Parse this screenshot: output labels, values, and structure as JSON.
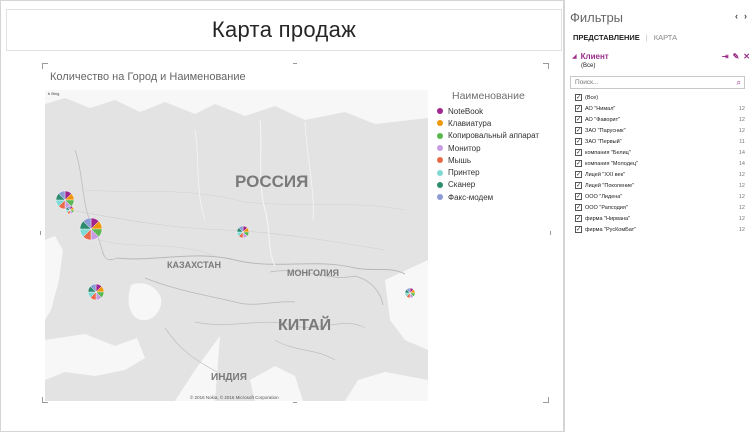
{
  "canvas": {
    "title": "Карта продаж"
  },
  "visual": {
    "title": "Количество на Город и Наименование",
    "map_labels": [
      "РОССИЯ",
      "КАЗАХСТАН",
      "МОНГОЛИЯ",
      "КИТАЙ",
      "ИНДИЯ"
    ],
    "copyright": "© 2016 Nokia, © 2016 Microsoft Corporation",
    "bing_label": "b Bing"
  },
  "legend": {
    "title": "Наименование",
    "items": [
      {
        "label": "NoteBook",
        "color": "#a0258c"
      },
      {
        "label": "Клавиатура",
        "color": "#f0960a"
      },
      {
        "label": "Копировальный аппарат",
        "color": "#59b84f"
      },
      {
        "label": "Монитор",
        "color": "#c79be0"
      },
      {
        "label": "Мышь",
        "color": "#e96a4a"
      },
      {
        "label": "Принтер",
        "color": "#7fd9d4"
      },
      {
        "label": "Сканер",
        "color": "#2e8b6e"
      },
      {
        "label": "Факс-модем",
        "color": "#8a9bd6"
      }
    ]
  },
  "filters": {
    "header": "Фильтры",
    "header_icons": [
      "chevron-left",
      "chevron-right"
    ],
    "tabs": [
      "ПРЕДСТАВЛЕНИЕ",
      "КАРТА"
    ],
    "active_tab": "ПРЕДСТАВЛЕНИЕ",
    "field": {
      "name": "Клиент",
      "state": "(Все)"
    },
    "search_placeholder": "Поиск...",
    "items": [
      {
        "label": "(Все)",
        "count": ""
      },
      {
        "label": "АО \"Нимал\"",
        "count": "12"
      },
      {
        "label": "АО \"Фаворит\"",
        "count": "12"
      },
      {
        "label": "ЗАО \"Парусник\"",
        "count": "12"
      },
      {
        "label": "ЗАО \"Первый\"",
        "count": "11"
      },
      {
        "label": "компания \"Белиц\"",
        "count": "14"
      },
      {
        "label": "компания \"Молодец\"",
        "count": "14"
      },
      {
        "label": "Лицей \"XXI век\"",
        "count": "12"
      },
      {
        "label": "Лицей \"Поколение\"",
        "count": "12"
      },
      {
        "label": "ООО \"Лидена\"",
        "count": "12"
      },
      {
        "label": "ООО \"Рапсодия\"",
        "count": "12"
      },
      {
        "label": "фирма \"Нирвана\"",
        "count": "12"
      },
      {
        "label": "фирма \"РусКомБат\"",
        "count": "12"
      }
    ]
  }
}
